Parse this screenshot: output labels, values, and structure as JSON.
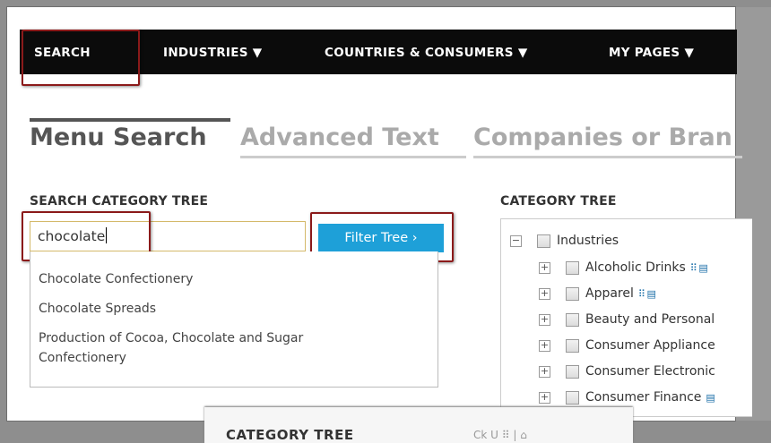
{
  "nav": {
    "items": [
      {
        "label": "SEARCH"
      },
      {
        "label": "INDUSTRIES ▼"
      },
      {
        "label": "COUNTRIES & CONSUMERS ▼"
      },
      {
        "label": "MY PAGES ▼"
      }
    ]
  },
  "tabs": [
    {
      "label": "Menu Search",
      "active": true
    },
    {
      "label": "Advanced Text",
      "active": false
    },
    {
      "label": "Companies or Bran",
      "active": false
    }
  ],
  "search_panel": {
    "title": "SEARCH CATEGORY TREE",
    "input_value": "chocolate",
    "filter_button": "Filter Tree ›",
    "suggestions": [
      "Chocolate Confectionery",
      "Chocolate Spreads",
      "Production of Cocoa, Chocolate and Sugar",
      "Confectionery"
    ]
  },
  "tree_panel": {
    "title": "CATEGORY TREE",
    "root": {
      "label": "Industries",
      "expander": "−"
    },
    "children": [
      {
        "label": "Alcoholic Drinks",
        "icons": "⠿ ▤"
      },
      {
        "label": "Apparel",
        "icons": "⠿ ▤"
      },
      {
        "label": "Beauty and Personal",
        "icons": ""
      },
      {
        "label": "Consumer Appliance",
        "icons": ""
      },
      {
        "label": "Consumer Electronic",
        "icons": ""
      },
      {
        "label": "Consumer Finance",
        "icons": "▤"
      }
    ],
    "child_expander": "+"
  },
  "bottom_window": {
    "title": "CATEGORY TREE",
    "right_text": "Ck  U  ⠿ | ⌂"
  },
  "colors": {
    "nav_bg": "#0b0b0b",
    "highlight": "#8b1a1a",
    "button": "#1ea0d8",
    "active_tab_line": "#555555",
    "inactive_tab_line": "#cccccc"
  }
}
